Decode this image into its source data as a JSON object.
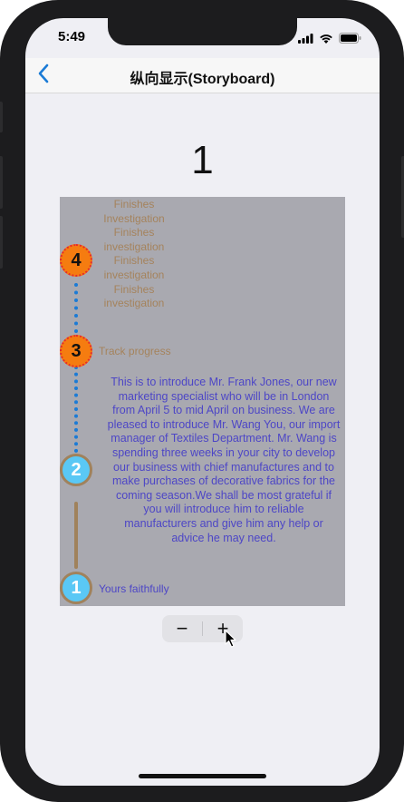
{
  "status": {
    "time": "5:49",
    "icons": [
      "signal-icon",
      "wifi-icon",
      "battery-icon"
    ]
  },
  "nav": {
    "back_icon": "chevron-left-icon",
    "title": "纵向显示(Storyboard)"
  },
  "counter": {
    "value": "1"
  },
  "timeline": {
    "node4": {
      "number": "4",
      "lines": [
        "Finishes",
        "Investigation",
        "Finishes",
        "investigation",
        "Finishes",
        "investigation",
        "Finishes",
        "investigation"
      ]
    },
    "node3": {
      "number": "3",
      "label": "Track progress"
    },
    "node2": {
      "number": "2",
      "text": "This is to introduce Mr. Frank Jones, our new marketing specialist who will be in London from April 5 to mid April on business. We are pleased to introduce Mr. Wang You, our import manager of Textiles Department. Mr. Wang is spending three weeks in your city to develop our business with chief manufactures and to make purchases of decorative fabrics for the coming season.We shall be most grateful if you will introduce him to reliable manufacturers and give him any help or advice he may need."
    },
    "node1": {
      "number": "1",
      "label": "Yours faithfully"
    }
  },
  "stepper": {
    "minus": "−",
    "plus": "+"
  },
  "colors": {
    "accent": "#1b7bd6",
    "orange_node": "#f57c10",
    "blue_node": "#5ac8f5",
    "brown": "#a0825c",
    "body_text": "#4d46c6",
    "panel": "#a9a9b0"
  }
}
